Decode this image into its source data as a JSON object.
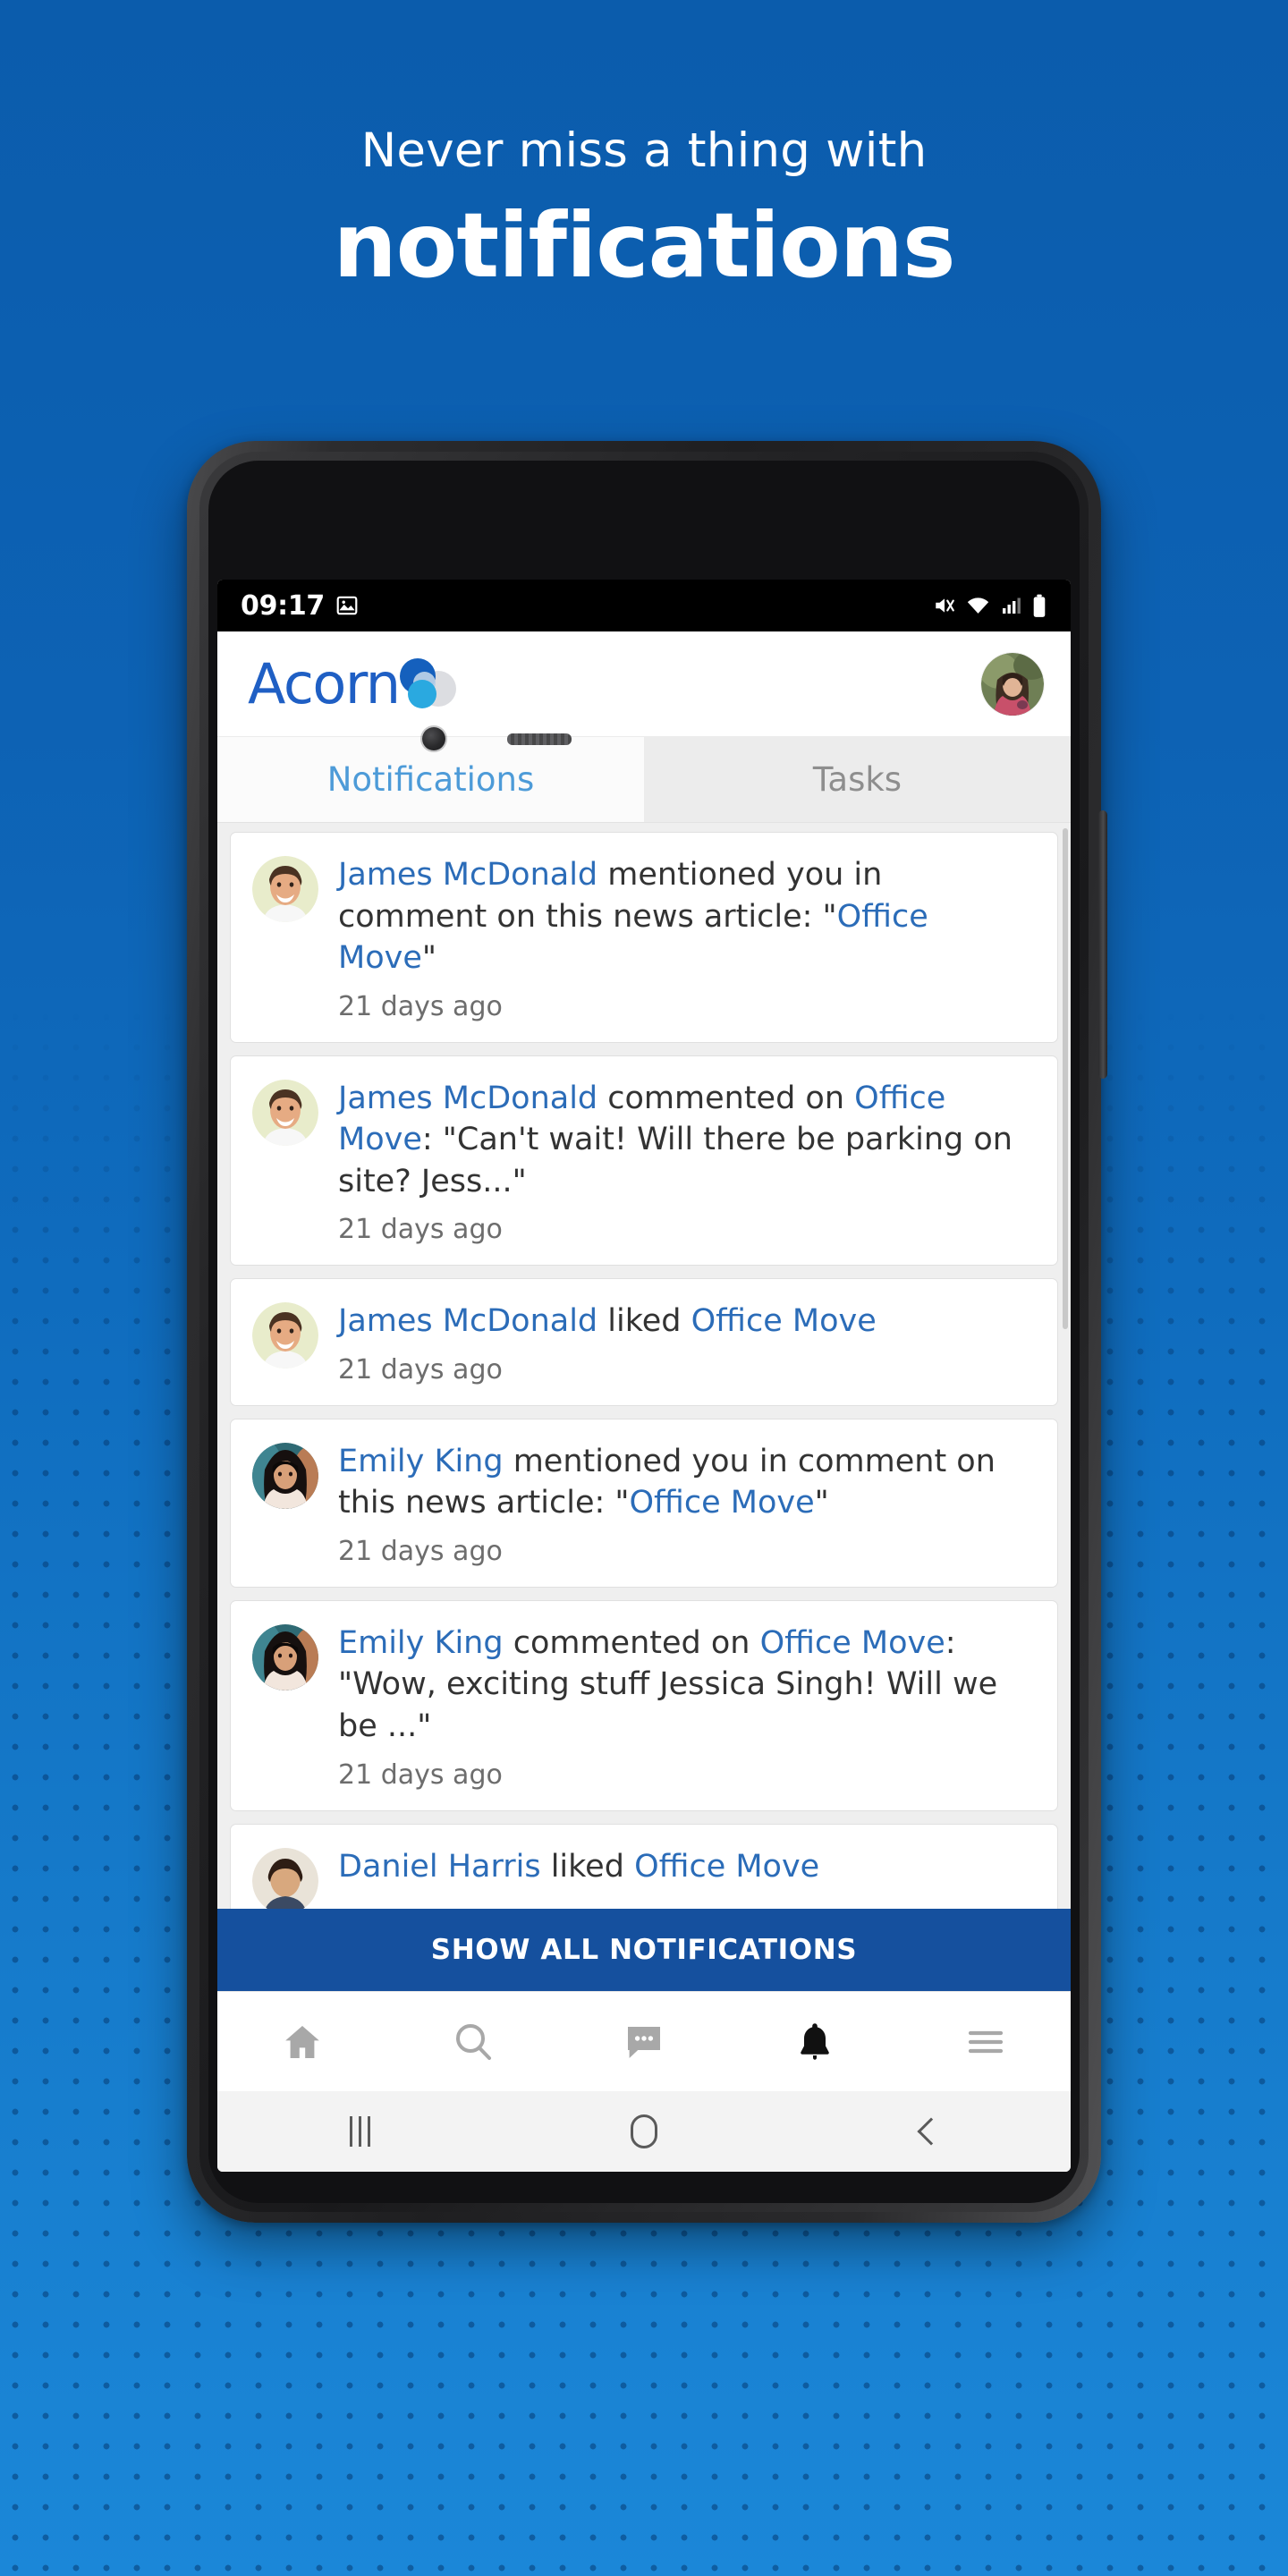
{
  "promo": {
    "line1": "Never miss a thing with",
    "line2": "notifications"
  },
  "colors": {
    "bg_top": "#0b5cac",
    "bg_bottom": "#1b87d8",
    "brand_blue": "#1f5fc4",
    "link_blue": "#2b6cb8",
    "tab_active": "#4d9bd8",
    "cta_bar": "#15509e"
  },
  "status_bar": {
    "time": "09:17",
    "icons": [
      "image-icon",
      "mute-icon",
      "wifi-icon",
      "signal-icon",
      "battery-icon"
    ]
  },
  "app_header": {
    "logo_text": "Acorn",
    "logo_mark": "acorn-circles-logo",
    "avatar": "user-avatar"
  },
  "tabs": [
    {
      "label": "Notifications",
      "active": true
    },
    {
      "label": "Tasks",
      "active": false
    }
  ],
  "notifications": [
    {
      "avatar": "james-mcdonald-avatar",
      "parts": [
        {
          "t": "James McDonald",
          "link": true
        },
        {
          "t": " mentioned you in comment on this news article: \"",
          "link": false
        },
        {
          "t": "Office Move",
          "link": true
        },
        {
          "t": "\"",
          "link": false
        }
      ],
      "time": "21 days ago"
    },
    {
      "avatar": "james-mcdonald-avatar",
      "parts": [
        {
          "t": "James McDonald",
          "link": true
        },
        {
          "t": " commented on ",
          "link": false
        },
        {
          "t": "Office Move",
          "link": true
        },
        {
          "t": ": \"Can't wait! Will there be parking on site? Jess...\"",
          "link": false
        }
      ],
      "time": "21 days ago"
    },
    {
      "avatar": "james-mcdonald-avatar",
      "parts": [
        {
          "t": "James McDonald",
          "link": true
        },
        {
          "t": " liked ",
          "link": false
        },
        {
          "t": "Office Move",
          "link": true
        }
      ],
      "time": "21 days ago"
    },
    {
      "avatar": "emily-king-avatar",
      "parts": [
        {
          "t": "Emily King",
          "link": true
        },
        {
          "t": " mentioned you in comment on this news article: \"",
          "link": false
        },
        {
          "t": "Office Move",
          "link": true
        },
        {
          "t": "\"",
          "link": false
        }
      ],
      "time": "21 days ago"
    },
    {
      "avatar": "emily-king-avatar",
      "parts": [
        {
          "t": "Emily King",
          "link": true
        },
        {
          "t": " commented on ",
          "link": false
        },
        {
          "t": "Office Move",
          "link": true
        },
        {
          "t": ": \"Wow, exciting stuff Jessica Singh! Will we be ...\"",
          "link": false
        }
      ],
      "time": "21 days ago"
    },
    {
      "avatar": "daniel-harris-avatar",
      "parts": [
        {
          "t": "Daniel Harris",
          "link": true
        },
        {
          "t": " liked ",
          "link": false
        },
        {
          "t": "Office Move",
          "link": true
        }
      ],
      "time": ""
    }
  ],
  "cta": {
    "label": "SHOW ALL NOTIFICATIONS"
  },
  "app_nav": [
    {
      "icon": "home-icon",
      "active": false
    },
    {
      "icon": "search-icon",
      "active": false
    },
    {
      "icon": "chat-icon",
      "active": false
    },
    {
      "icon": "bell-icon",
      "active": true
    },
    {
      "icon": "hamburger-menu-icon",
      "active": false
    }
  ],
  "system_nav": [
    {
      "icon": "recents-icon"
    },
    {
      "icon": "home-icon"
    },
    {
      "icon": "back-icon"
    }
  ]
}
